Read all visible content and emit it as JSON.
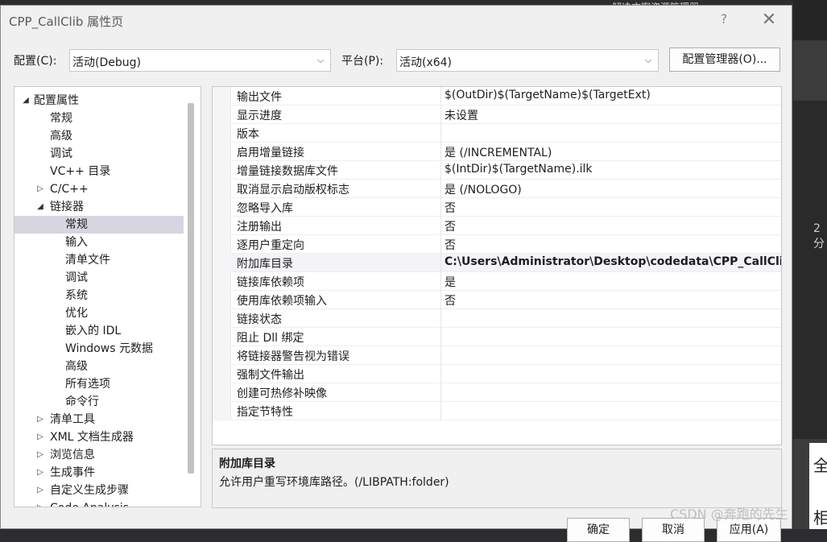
{
  "background": {
    "ide_title": "解决方案资源管理器",
    "ide_fragment_1": "2 分",
    "ide_fragment_2": "全",
    "ide_fragment_3": "相"
  },
  "dialog": {
    "title": "CPP_CallClib 属性页",
    "help": "?",
    "close": "✕"
  },
  "config": {
    "config_label": "配置(C):",
    "config_value": "活动(Debug)",
    "platform_label": "平台(P):",
    "platform_value": "活动(x64)",
    "manager_button": "配置管理器(O)..."
  },
  "tree": {
    "items": [
      {
        "label": "配置属性",
        "level": 0,
        "expander": "◢"
      },
      {
        "label": "常规",
        "level": 1,
        "expander": ""
      },
      {
        "label": "高级",
        "level": 1,
        "expander": ""
      },
      {
        "label": "调试",
        "level": 1,
        "expander": ""
      },
      {
        "label": "VC++ 目录",
        "level": 1,
        "expander": ""
      },
      {
        "label": "C/C++",
        "level": 1,
        "expander": "▷"
      },
      {
        "label": "链接器",
        "level": 1,
        "expander": "◢"
      },
      {
        "label": "常规",
        "level": 2,
        "expander": ""
      },
      {
        "label": "输入",
        "level": 2,
        "expander": ""
      },
      {
        "label": "清单文件",
        "level": 2,
        "expander": ""
      },
      {
        "label": "调试",
        "level": 2,
        "expander": ""
      },
      {
        "label": "系统",
        "level": 2,
        "expander": ""
      },
      {
        "label": "优化",
        "level": 2,
        "expander": ""
      },
      {
        "label": "嵌入的 IDL",
        "level": 2,
        "expander": ""
      },
      {
        "label": "Windows 元数据",
        "level": 2,
        "expander": ""
      },
      {
        "label": "高级",
        "level": 2,
        "expander": ""
      },
      {
        "label": "所有选项",
        "level": 2,
        "expander": ""
      },
      {
        "label": "命令行",
        "level": 2,
        "expander": ""
      },
      {
        "label": "清单工具",
        "level": 1,
        "expander": "▷"
      },
      {
        "label": "XML 文档生成器",
        "level": 1,
        "expander": "▷"
      },
      {
        "label": "浏览信息",
        "level": 1,
        "expander": "▷"
      },
      {
        "label": "生成事件",
        "level": 1,
        "expander": "▷"
      },
      {
        "label": "自定义生成步骤",
        "level": 1,
        "expander": "▷"
      },
      {
        "label": "Code Analysis",
        "level": 1,
        "expander": "▷"
      }
    ],
    "selected_index": 7
  },
  "properties": {
    "rows": [
      {
        "name": "输出文件",
        "value": "$(OutDir)$(TargetName)$(TargetExt)",
        "bold": false
      },
      {
        "name": "显示进度",
        "value": "未设置",
        "bold": false
      },
      {
        "name": "版本",
        "value": "",
        "bold": false
      },
      {
        "name": "启用增量链接",
        "value": "是 (/INCREMENTAL)",
        "bold": false
      },
      {
        "name": "增量链接数据库文件",
        "value": "$(IntDir)$(TargetName).ilk",
        "bold": false
      },
      {
        "name": "取消显示启动版权标志",
        "value": "是 (/NOLOGO)",
        "bold": false
      },
      {
        "name": "忽略导入库",
        "value": "否",
        "bold": false
      },
      {
        "name": "注册输出",
        "value": "否",
        "bold": false
      },
      {
        "name": "逐用户重定向",
        "value": "否",
        "bold": false
      },
      {
        "name": "附加库目录",
        "value": "C:\\Users\\Administrator\\Desktop\\codedata\\CPP_CallClib",
        "bold": true
      },
      {
        "name": "链接库依赖项",
        "value": "是",
        "bold": false
      },
      {
        "name": "使用库依赖项输入",
        "value": "否",
        "bold": false
      },
      {
        "name": "链接状态",
        "value": "",
        "bold": false
      },
      {
        "name": "阻止 Dll 绑定",
        "value": "",
        "bold": false
      },
      {
        "name": "将链接器警告视为错误",
        "value": "",
        "bold": false
      },
      {
        "name": "强制文件输出",
        "value": "",
        "bold": false
      },
      {
        "name": "创建可热修补映像",
        "value": "",
        "bold": false
      },
      {
        "name": "指定节特性",
        "value": "",
        "bold": false
      }
    ],
    "selected_index": 9
  },
  "description": {
    "title": "附加库目录",
    "text": "允许用户重写环境库路径。(/LIBPATH:folder)"
  },
  "buttons": {
    "ok": "确定",
    "cancel": "取消",
    "apply": "应用(A)"
  },
  "watermark": "CSDN @奔跑的先生"
}
